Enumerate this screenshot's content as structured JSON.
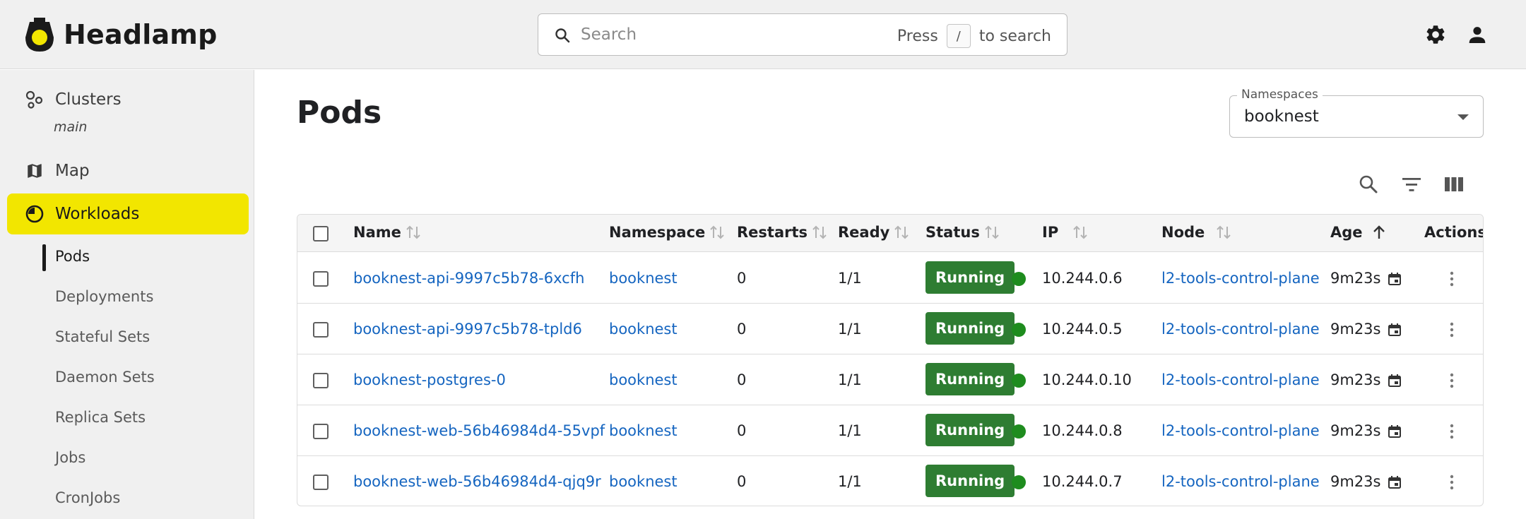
{
  "app": {
    "name": "Headlamp",
    "colors": {
      "accent": "#f2e600",
      "link": "#1565c0",
      "running": "#2e7d32",
      "status_dot": "#1e8c1e"
    }
  },
  "search": {
    "placeholder": "Search",
    "hint_prefix": "Press",
    "hint_key": "/",
    "hint_suffix": "to search"
  },
  "header_icons": [
    "settings-icon",
    "account-icon"
  ],
  "sidebar": {
    "clusters_label": "Clusters",
    "cluster_name": "main",
    "map_label": "Map",
    "workloads_label": "Workloads",
    "subitems": [
      "Pods",
      "Deployments",
      "Stateful Sets",
      "Daemon Sets",
      "Replica Sets",
      "Jobs",
      "CronJobs"
    ],
    "active_subitem": "Pods"
  },
  "page": {
    "title": "Pods"
  },
  "namespace_select": {
    "label": "Namespaces",
    "value": "booknest"
  },
  "toolbar_icons": [
    "search-icon",
    "filter-icon",
    "columns-icon"
  ],
  "table": {
    "columns": [
      "Name",
      "Namespace",
      "Restarts",
      "Ready",
      "Status",
      "IP",
      "Node",
      "Age",
      "Actions"
    ],
    "sort_column": "Age",
    "sort_direction": "ascending",
    "rows": [
      {
        "name": "booknest-api-9997c5b78-6xcfh",
        "namespace": "booknest",
        "restarts": "0",
        "ready": "1/1",
        "status": "Running",
        "ip": "10.244.0.6",
        "node": "l2-tools-control-plane",
        "age": "9m23s"
      },
      {
        "name": "booknest-api-9997c5b78-tpld6",
        "namespace": "booknest",
        "restarts": "0",
        "ready": "1/1",
        "status": "Running",
        "ip": "10.244.0.5",
        "node": "l2-tools-control-plane",
        "age": "9m23s"
      },
      {
        "name": "booknest-postgres-0",
        "namespace": "booknest",
        "restarts": "0",
        "ready": "1/1",
        "status": "Running",
        "ip": "10.244.0.10",
        "node": "l2-tools-control-plane",
        "age": "9m23s"
      },
      {
        "name": "booknest-web-56b46984d4-55vpf",
        "namespace": "booknest",
        "restarts": "0",
        "ready": "1/1",
        "status": "Running",
        "ip": "10.244.0.8",
        "node": "l2-tools-control-plane",
        "age": "9m23s"
      },
      {
        "name": "booknest-web-56b46984d4-qjq9r",
        "namespace": "booknest",
        "restarts": "0",
        "ready": "1/1",
        "status": "Running",
        "ip": "10.244.0.7",
        "node": "l2-tools-control-plane",
        "age": "9m23s"
      }
    ]
  }
}
